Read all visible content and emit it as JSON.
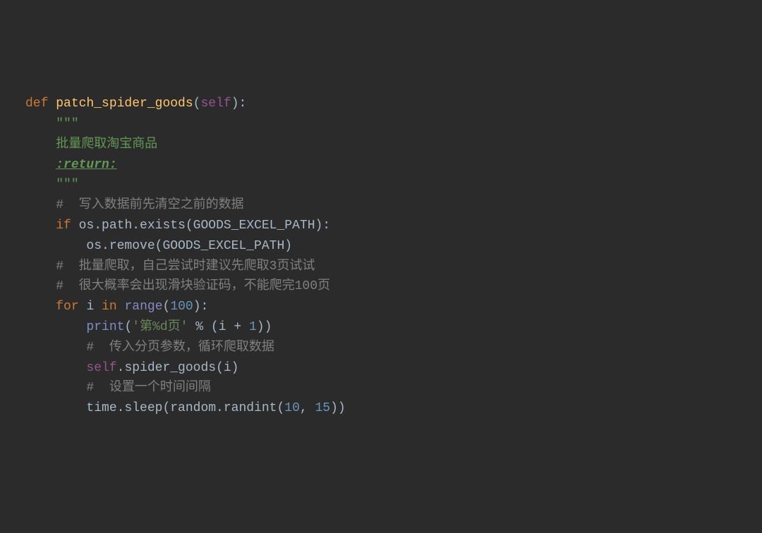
{
  "code": {
    "line1": {
      "kw_def": "def",
      "fn_name": "patch_spider_goods",
      "param": "self"
    },
    "line2": {
      "docq": "\"\"\""
    },
    "line3": {
      "desc": "批量爬取淘宝商品"
    },
    "line4": {
      "tag": ":return:"
    },
    "line5": {
      "docq": "\"\"\""
    },
    "line6": {
      "comment": "#  写入数据前先清空之前的数据"
    },
    "line7": {
      "kw_if": "if",
      "id_os": "os.path.exists(GOODS_EXCEL_PATH):"
    },
    "line8": {
      "id_osremove": "os.remove(GOODS_EXCEL_PATH)"
    },
    "line9": {
      "comment": "#  批量爬取，自己尝试时建议先爬取3页试试"
    },
    "line10": {
      "comment": "#  很大概率会出现滑块验证码，不能爬完100页"
    },
    "line11": {
      "kw_for": "for",
      "var_i": "i",
      "kw_in": "in",
      "range": "range",
      "num": "100"
    },
    "line12": {
      "print": "print",
      "str": "'第%d页'",
      "mod": "%",
      "var_i": "i",
      "plus": "+",
      "one": "1"
    },
    "line13": {
      "comment": "#  传入分页参数，循环爬取数据"
    },
    "line14": {
      "kw_self": "self",
      "call": ".spider_goods(i)"
    },
    "line15": {
      "comment": "#  设置一个时间间隔"
    },
    "line16": {
      "time": "time.sleep(random.randint(",
      "n1": "10",
      "comma": ", ",
      "n2": "15",
      "close": "))"
    }
  }
}
